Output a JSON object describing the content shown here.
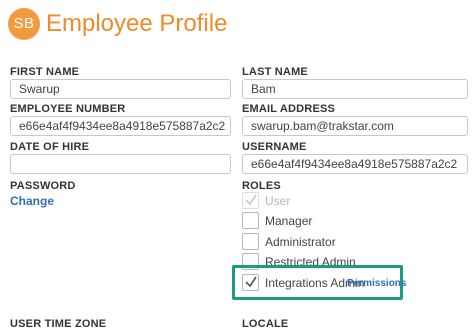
{
  "header": {
    "avatar_initials": "SB",
    "title": "Employee Profile",
    "accent_color": "#f08a2a"
  },
  "form": {
    "first_name": {
      "label": "FIRST NAME",
      "value": "Swarup"
    },
    "last_name": {
      "label": "LAST NAME",
      "value": "Bam"
    },
    "employee_number": {
      "label": "EMPLOYEE NUMBER",
      "value": "e66e4af4f9434ee8a4918e575887a2c2"
    },
    "email": {
      "label": "EMAIL ADDRESS",
      "value": "swarup.bam@trakstar.com"
    },
    "date_of_hire": {
      "label": "DATE OF HIRE",
      "value": ""
    },
    "username": {
      "label": "USERNAME",
      "value": "e66e4af4f9434ee8a4918e575887a2c2"
    },
    "password": {
      "label": "PASSWORD",
      "change_link": "Change"
    },
    "roles": {
      "label": "ROLES",
      "items": [
        {
          "label": "User",
          "checked": true,
          "disabled": true
        },
        {
          "label": "Manager",
          "checked": false,
          "disabled": false
        },
        {
          "label": "Administrator",
          "checked": false,
          "disabled": false
        },
        {
          "label": "Restricted Admin",
          "checked": false,
          "disabled": false
        },
        {
          "label": "Integrations Admin",
          "checked": true,
          "disabled": false,
          "link": "Permissions"
        }
      ]
    },
    "user_time_zone": {
      "label": "USER TIME ZONE"
    },
    "locale": {
      "label": "LOCALE"
    }
  },
  "highlight_color": "#1b9b86",
  "link_color": "#2f6fb4"
}
